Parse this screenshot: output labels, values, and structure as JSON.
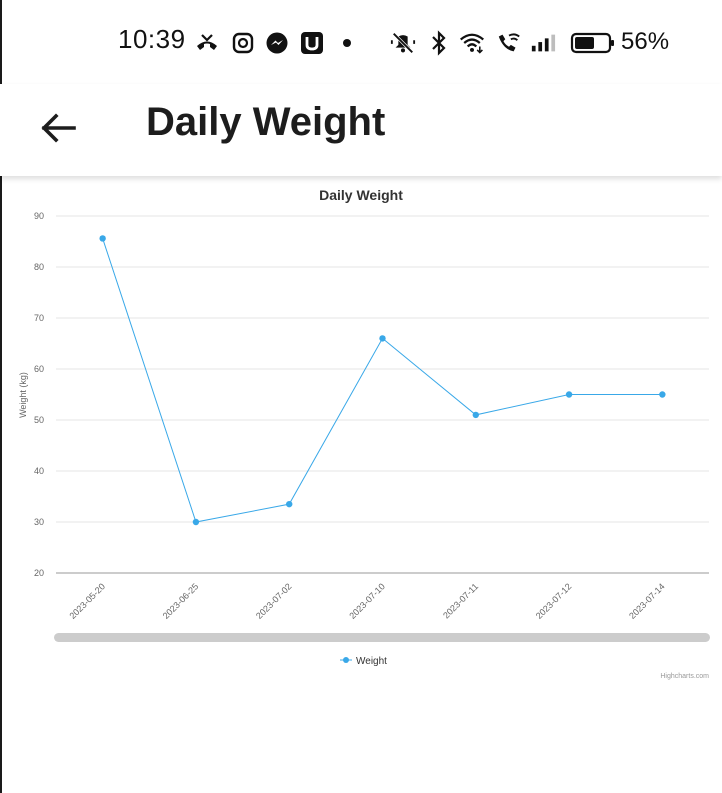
{
  "status_bar": {
    "time": "10:39",
    "battery_percent": "56%",
    "icons": [
      "missed-call-icon",
      "camera-app-icon",
      "messenger-icon",
      "u-app-icon",
      "notification-dot-icon",
      "mute-icon",
      "bluetooth-icon",
      "wifi-icon",
      "wifi-calling-icon",
      "signal-icon",
      "battery-icon"
    ]
  },
  "app_bar": {
    "title": "Daily Weight",
    "back_icon": "arrow-left-icon"
  },
  "chart_data": {
    "type": "line",
    "title": "Daily Weight",
    "ylabel": "Weight (kg)",
    "xlabel": "",
    "categories": [
      "2023-05-20",
      "2023-06-25",
      "2023-07-02",
      "2023-07-10",
      "2023-07-11",
      "2023-07-12",
      "2023-07-14"
    ],
    "series": [
      {
        "name": "Weight",
        "values": [
          85.6,
          30,
          33.5,
          66,
          51,
          55,
          55
        ],
        "color": "#39a8e8"
      }
    ],
    "ylim": [
      20,
      90
    ],
    "yticks": [
      20,
      30,
      40,
      50,
      60,
      70,
      80,
      90
    ],
    "grid": true,
    "legend": "bottom-center",
    "credits": "Highcharts.com",
    "scrollbar": true
  },
  "colors": {
    "series": "#39a8e8",
    "grid": "#e6e6e6",
    "axis": "#999999",
    "scrollbar": "#cccccc"
  }
}
